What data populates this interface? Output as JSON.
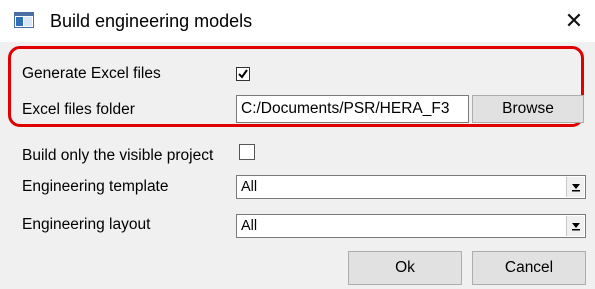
{
  "window": {
    "title": "Build engineering models",
    "close_glyph": "✕",
    "icon": "app-window-icon",
    "highlight_color": "#e00000"
  },
  "form": {
    "generate_excel": {
      "label": "Generate Excel files",
      "checked": true
    },
    "excel_folder": {
      "label": "Excel files folder",
      "value": "C:/Documents/PSR/HERA_F3",
      "browse_label": "Browse"
    },
    "build_visible": {
      "label": "Build only the visible project",
      "checked": false
    },
    "engineering_template": {
      "label": "Engineering template",
      "value": "All"
    },
    "engineering_layout": {
      "label": "Engineering layout",
      "value": "All"
    }
  },
  "buttons": {
    "ok": "Ok",
    "cancel": "Cancel"
  }
}
